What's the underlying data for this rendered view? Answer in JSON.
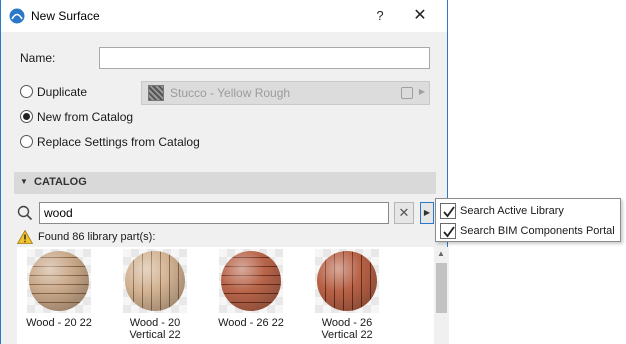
{
  "window": {
    "title": "New Surface",
    "help_label": "?",
    "close_label": "✕"
  },
  "form": {
    "name_label": "Name:",
    "name_value": "",
    "options": [
      {
        "label": "Duplicate",
        "checked": false
      },
      {
        "label": "New from Catalog",
        "checked": true
      },
      {
        "label": "Replace Settings from Catalog",
        "checked": false
      }
    ],
    "duplicate_source": "Stucco - Yellow Rough"
  },
  "catalog": {
    "header": "CATALOG",
    "search_value": "wood",
    "clear_label": "✕",
    "options_label": "▶",
    "found_text": "Found 86 library part(s):",
    "items": [
      {
        "line1": "Wood - 20 22",
        "line2": "",
        "color_a": "#c9a98a",
        "color_b": "#8a6446",
        "direction": "horizontal"
      },
      {
        "line1": "Wood - 20",
        "line2": "Vertical 22",
        "color_a": "#d2b393",
        "color_b": "#8f6a4a",
        "direction": "vertical"
      },
      {
        "line1": "Wood - 26 22",
        "line2": "",
        "color_a": "#b8654a",
        "color_b": "#6e2f1e",
        "direction": "horizontal"
      },
      {
        "line1": "Wood - 26",
        "line2": "Vertical 22",
        "color_a": "#b86246",
        "color_b": "#6a2d1c",
        "direction": "vertical"
      }
    ]
  },
  "search_menu": {
    "items": [
      {
        "label": "Search Active Library",
        "checked": true
      },
      {
        "label": "Search BIM Components Portal",
        "checked": true
      }
    ]
  },
  "colors": {
    "accent": "#2b78c8",
    "dialog_bg": "#f0f0f0",
    "header_bg": "#d9d9d9"
  }
}
